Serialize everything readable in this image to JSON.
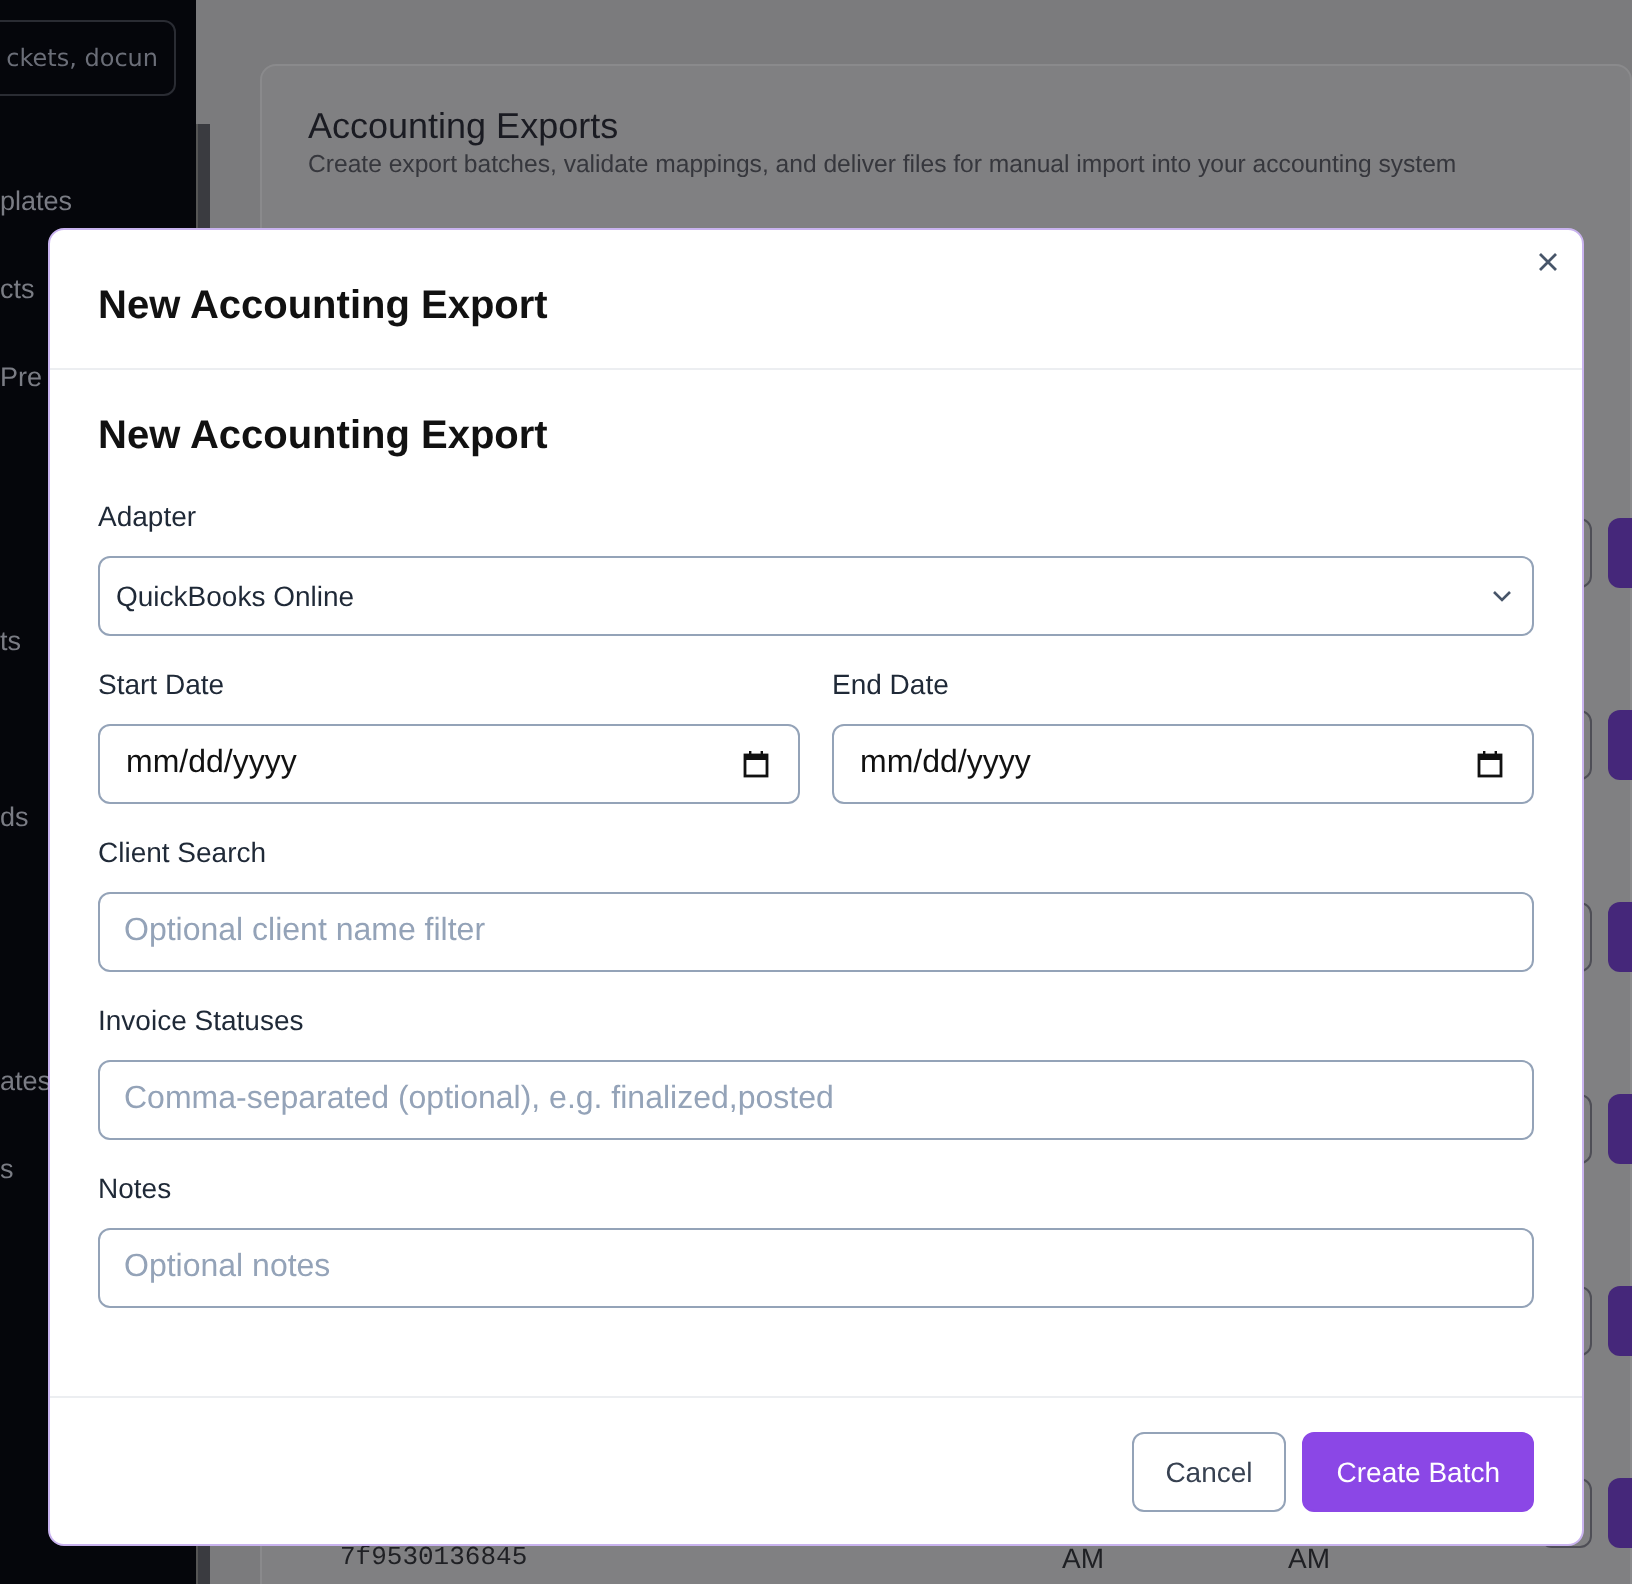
{
  "sidebar": {
    "search": {
      "placeholder": "ckets, docun"
    },
    "items": [
      {
        "label": "plates"
      },
      {
        "label": "cts"
      },
      {
        "label": "Pre"
      },
      {
        "label": "ts"
      },
      {
        "label": "ds"
      },
      {
        "label": "ates"
      },
      {
        "label": "s"
      }
    ]
  },
  "page": {
    "card": {
      "title": "Accounting Exports",
      "subtitle": "Create export batches, validate mappings, and deliver files for manual import into your accounting system"
    },
    "table": {
      "rows": [
        {
          "column_1": "7f9530136845",
          "column_2": "AM",
          "column_3": "AM"
        }
      ]
    }
  },
  "modal": {
    "title": "New Accounting Export",
    "heading": "New Accounting Export",
    "fields": [
      {
        "kind": "select",
        "label": "Adapter",
        "value": "QuickBooks Online"
      },
      {
        "kind": "date",
        "label": "Start Date",
        "placeholder": "mm/dd/yyyy"
      },
      {
        "kind": "date",
        "label": "End Date",
        "placeholder": "mm/dd/yyyy"
      },
      {
        "kind": "text",
        "label": "Client Search",
        "placeholder": "Optional client name filter"
      },
      {
        "kind": "text",
        "label": "Invoice Statuses",
        "placeholder": "Comma-separated (optional), e.g. finalized,posted"
      },
      {
        "kind": "text",
        "label": "Notes",
        "placeholder": "Optional notes"
      }
    ],
    "buttons": [
      {
        "label": "Cancel",
        "kind": "secondary"
      },
      {
        "label": "Create Batch",
        "kind": "primary"
      }
    ]
  }
}
